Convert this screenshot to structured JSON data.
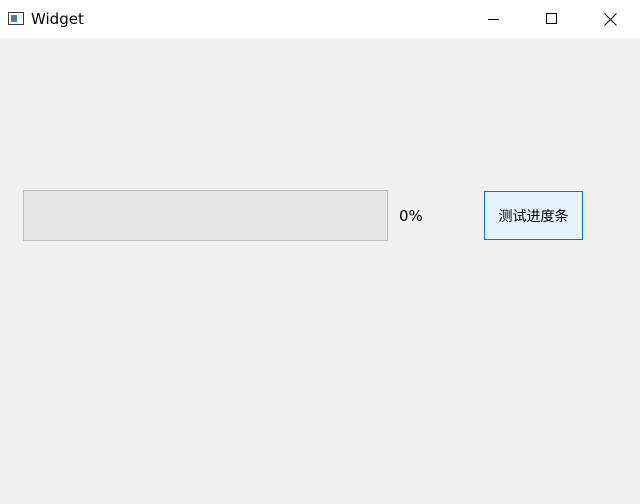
{
  "window": {
    "title": "Widget",
    "icon": "app-window-icon",
    "controls": {
      "minimize_icon": "minimize-icon",
      "maximize_icon": "maximize-icon",
      "close_icon": "close-icon"
    }
  },
  "progress": {
    "value": 0,
    "label": "0%",
    "fill_color": "#06b025"
  },
  "button": {
    "label": "测试进度条",
    "accent_color": "#0078d7"
  }
}
